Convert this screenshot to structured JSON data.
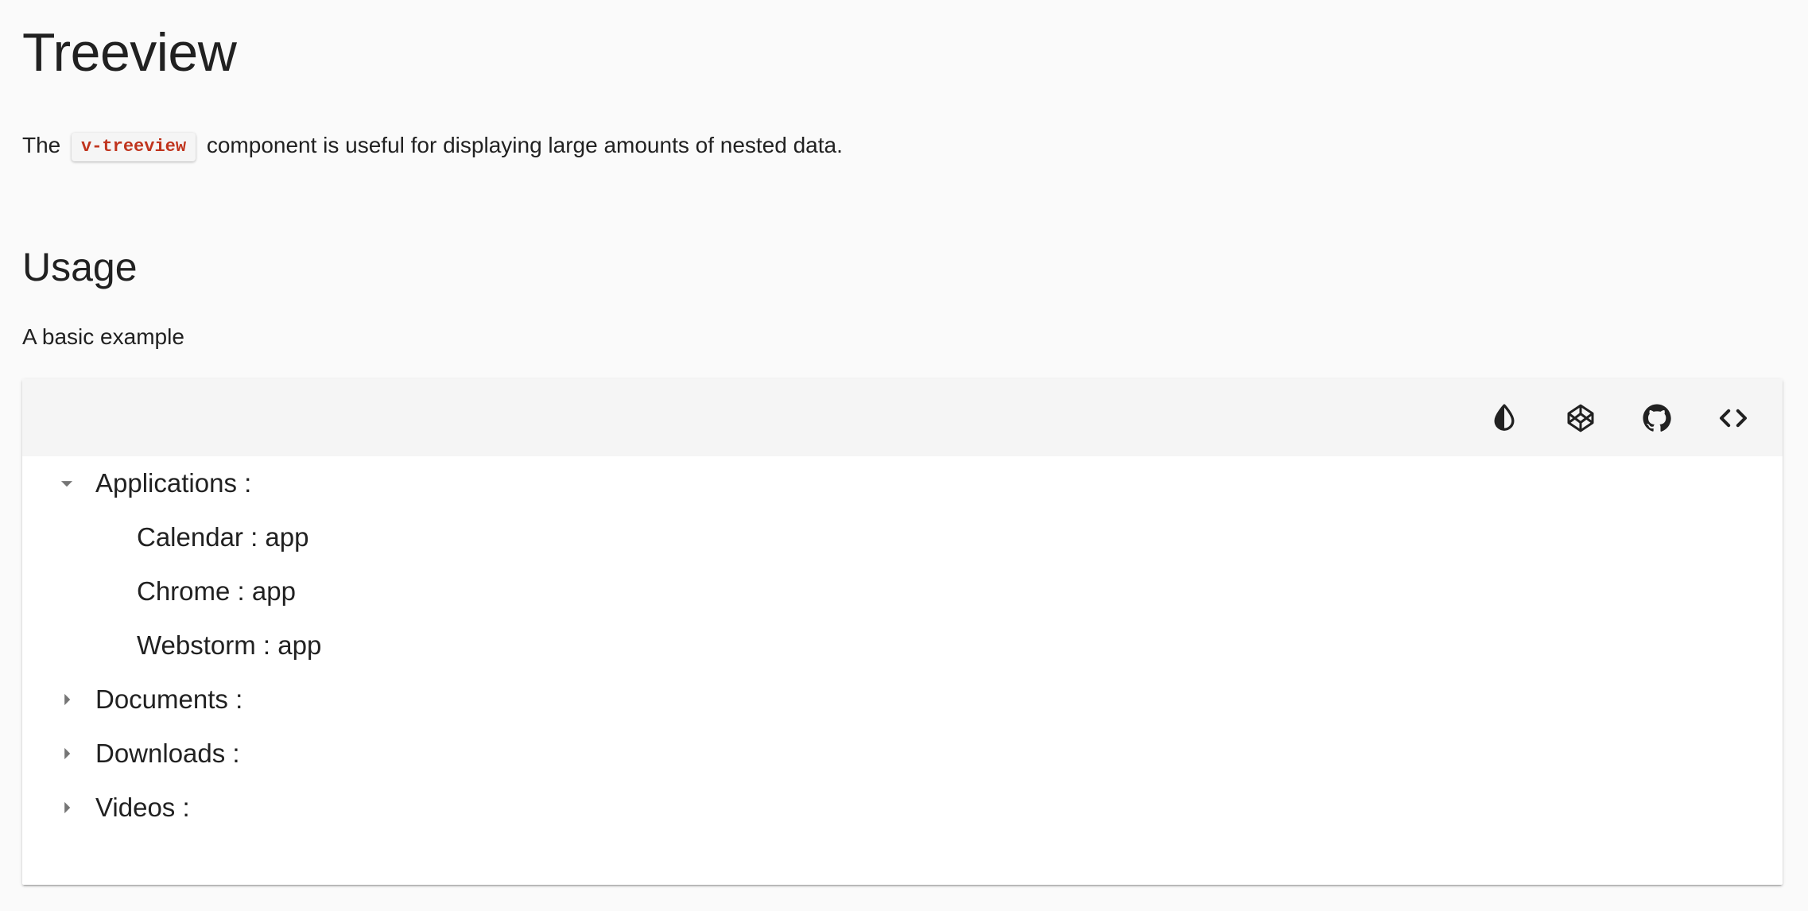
{
  "header": {
    "title": "Treeview",
    "intro_before": "The",
    "intro_code": "v-treeview",
    "intro_after": "component is useful for displaying large amounts of nested data."
  },
  "usage": {
    "heading": "Usage",
    "description": "A basic example"
  },
  "toolbar": {
    "icons": [
      "invert-colors-icon",
      "codepen-icon",
      "github-icon",
      "code-icon"
    ]
  },
  "tree": {
    "nodes": [
      {
        "label": "Applications :",
        "expanded": true,
        "icon": "caret-down-icon"
      },
      {
        "label": "Calendar : app"
      },
      {
        "label": "Chrome : app"
      },
      {
        "label": "Webstorm : app"
      },
      {
        "label": "Documents :",
        "expanded": false,
        "icon": "caret-right-icon"
      },
      {
        "label": "Downloads :",
        "expanded": false,
        "icon": "caret-right-icon"
      },
      {
        "label": "Videos :",
        "expanded": false,
        "icon": "caret-right-icon"
      }
    ]
  },
  "colors": {
    "code_text": "#c0341d",
    "toolbar_bg": "#f5f5f5",
    "page_bg": "#fafafa",
    "toggle_icon": "#757575"
  }
}
